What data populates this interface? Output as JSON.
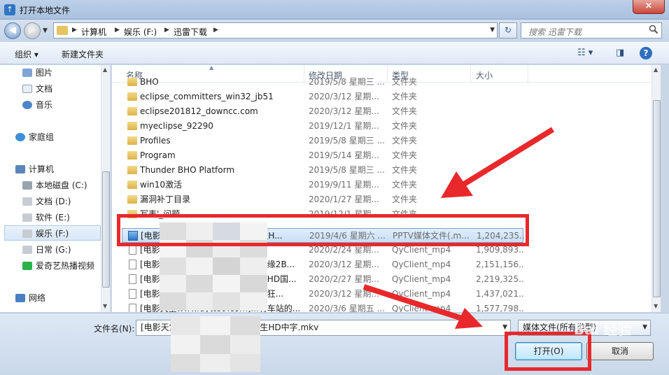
{
  "window": {
    "title": "打开本地文件",
    "close_glyph": "×"
  },
  "address": {
    "crumbs": [
      "计算机",
      "娱乐 (F:)",
      "迅雷下载"
    ],
    "search_placeholder": "搜索 迅雷下载"
  },
  "toolbar": {
    "organize": "组织",
    "new_folder": "新建文件夹",
    "help": "?"
  },
  "nav": {
    "items": [
      {
        "label": "图片",
        "icon": "pictures-icon"
      },
      {
        "label": "文档",
        "icon": "documents-icon"
      },
      {
        "label": "音乐",
        "icon": "music-icon"
      },
      {
        "label": "家庭组",
        "icon": "homegroup-icon"
      },
      {
        "label": "计算机",
        "icon": "computer-icon"
      },
      {
        "label": "本地磁盘 (C:)",
        "icon": "drive-icon"
      },
      {
        "label": "文档 (D:)",
        "icon": "drive-icon"
      },
      {
        "label": "软件 (E:)",
        "icon": "drive-icon"
      },
      {
        "label": "娱乐 (F:)",
        "icon": "drive-icon"
      },
      {
        "label": "日常 (G:)",
        "icon": "drive-icon"
      },
      {
        "label": "爱奇艺热播视频",
        "icon": "iqiyi-icon"
      },
      {
        "label": "网络",
        "icon": "network-icon"
      }
    ],
    "selected_index": 8
  },
  "columns": {
    "name": "名称",
    "date": "修改日期",
    "type": "类型",
    "size": "大小"
  },
  "files": [
    {
      "name": "BHO",
      "date": "2019/5/8 星期三 ...",
      "type": "文件夹",
      "size": "",
      "kind": "folder"
    },
    {
      "name": "eclipse_committers_win32_jb51",
      "date": "2020/3/12 星期...",
      "type": "文件夹",
      "size": "",
      "kind": "folder"
    },
    {
      "name": "eclipse201812_downcc.com",
      "date": "2020/3/12 星期...",
      "type": "文件夹",
      "size": "",
      "kind": "folder"
    },
    {
      "name": "myeclipse_92290",
      "date": "2019/12/1 星期...",
      "type": "文件夹",
      "size": "",
      "kind": "folder"
    },
    {
      "name": "Profiles",
      "date": "2019/5/8 星期三 ...",
      "type": "文件夹",
      "size": "",
      "kind": "folder"
    },
    {
      "name": "Program",
      "date": "2019/5/14 星期...",
      "type": "文件夹",
      "size": "",
      "kind": "folder"
    },
    {
      "name": "Thunder BHO Platform",
      "date": "2019/5/8 星期三 ...",
      "type": "文件夹",
      "size": "",
      "kind": "folder"
    },
    {
      "name": "win10激活",
      "date": "2019/9/11 星期...",
      "type": "文件夹",
      "size": "",
      "kind": "folder"
    },
    {
      "name": "漏洞补丁目录",
      "date": "2020/1/27 星期...",
      "type": "文件夹",
      "size": "",
      "kind": "folder"
    },
    {
      "name": "写表'_问题",
      "date": "2019/12/1 星期...",
      "type": "文件夹",
      "size": "",
      "kind": "folder"
    },
    {
      "name": "[电影天堂www.dytt89.com]逃生H...",
      "date": "2019/4/6 星期六 ...",
      "type": "PPTV媒体文件(.m...",
      "size": "1,204,235...",
      "kind": "video"
    },
    {
      "name": "[电影天堂www.dytt89.com]...",
      "date": "2020/2/24 星期...",
      "type": "QyClient_mp4",
      "size": "1,909,893...",
      "kind": "doc"
    },
    {
      "name": "[电影天堂www.dytt89.com]...奇缘2B...",
      "date": "2020/3/12 星期...",
      "type": "QyClient_mp4",
      "size": "2,151,156...",
      "kind": "doc"
    },
    {
      "name": "[电影天堂www.dytt89.com]...人HD国...",
      "date": "2020/2/27 星期...",
      "type": "QyClient_mp4",
      "size": "2,219,325...",
      "kind": "doc"
    },
    {
      "name": "[电影天堂www.dytt89.com]...：狂...",
      "date": "2020/3/12 星期...",
      "type": "QyClient_mp4",
      "size": "1,437,021...",
      "kind": "doc"
    },
    {
      "name": "[电影天堂www.dytt89.com]...有车站的...",
      "date": "2020/3/6 星期五 ...",
      "type": "QyClient_mp4",
      "size": "1,577,798...",
      "kind": "doc"
    }
  ],
  "selected_file_index": 10,
  "bottom": {
    "filename_label": "文件名(N):",
    "filename_value": "[电影天堂www.dytt89.com]逃生HD中字.mkv",
    "filetype_value": "媒体文件(所有类型)",
    "open_label": "打开(O)",
    "cancel_label": "取消"
  },
  "watermark": "Bai 经验",
  "colors": {
    "annotation_red": "#e8282b",
    "selection_blue": "#c8def6"
  }
}
